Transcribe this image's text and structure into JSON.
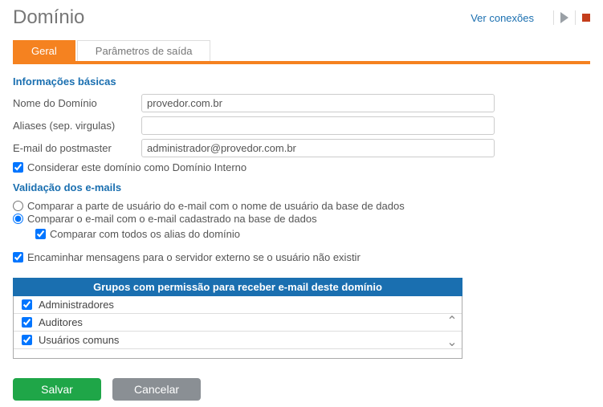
{
  "header": {
    "title": "Domínio",
    "link": "Ver conexões"
  },
  "tabs": {
    "general": "Geral",
    "output_params": "Parâmetros de saída"
  },
  "section_basic": {
    "title": "Informações básicas",
    "domain_name_label": "Nome do Domínio",
    "domain_name_value": "provedor.com.br",
    "aliases_label": "Aliases (sep. virgulas)",
    "aliases_value": "",
    "postmaster_label": "E-mail do postmaster",
    "postmaster_value": "administrador@provedor.com.br",
    "internal_domain_label": "Considerar este domínio como Domínio Interno"
  },
  "section_validation": {
    "title": "Validação dos e-mails",
    "opt_user_part": "Comparar a parte de usuário do e-mail com o nome de usuário da base de dados",
    "opt_email_db": "Comparar o e-mail com o e-mail cadastrado na base de dados",
    "chk_all_alias": "Comparar com todos os alias do domínio",
    "chk_forward": "Encaminhar mensagens para o servidor externo se o usuário não existir"
  },
  "groups": {
    "title": "Grupos com permissão para receber e-mail deste domínio",
    "items": [
      {
        "label": "Administradores"
      },
      {
        "label": "Auditores"
      },
      {
        "label": "Usuários comuns"
      }
    ]
  },
  "footer": {
    "save": "Salvar",
    "cancel": "Cancelar"
  }
}
